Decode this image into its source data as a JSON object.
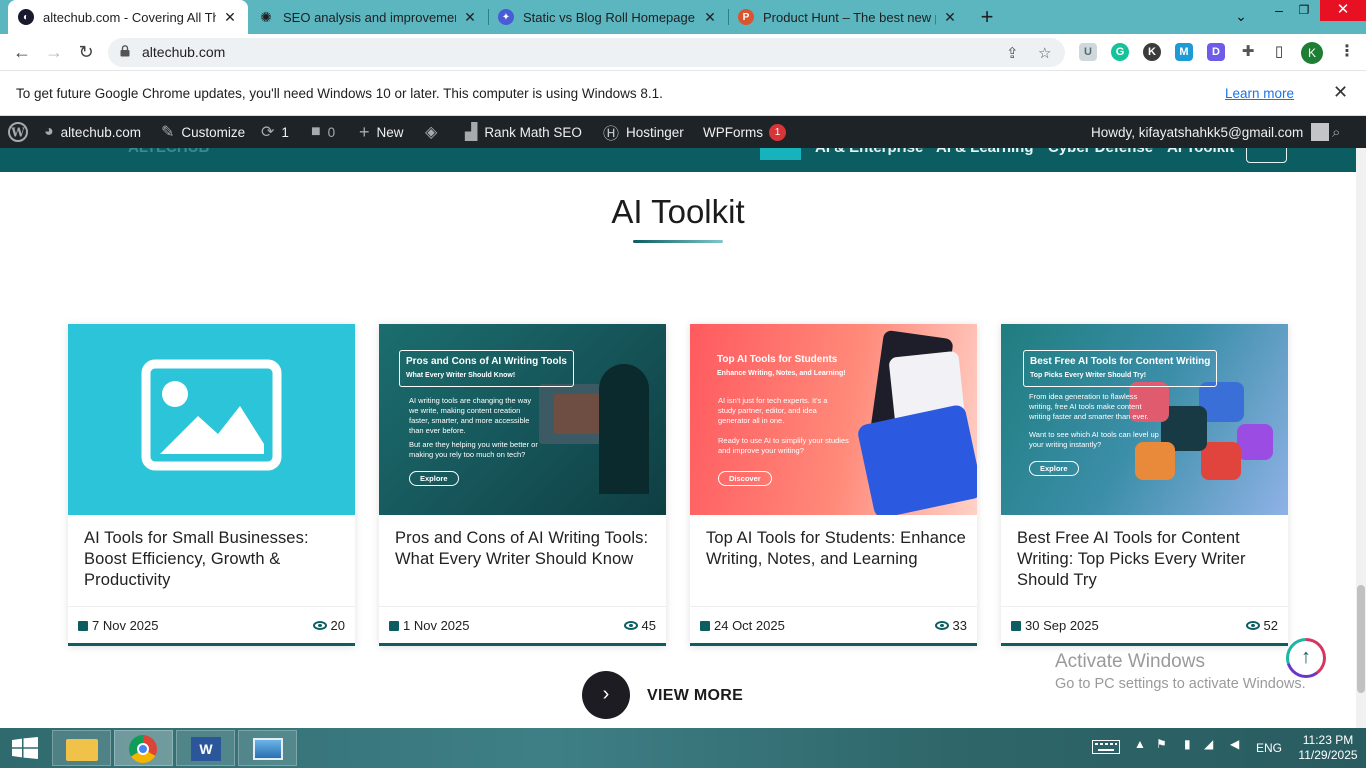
{
  "browser": {
    "tabs": [
      {
        "title": "altechub.com - Covering All Thin",
        "active": true
      },
      {
        "title": "SEO analysis and improvements",
        "active": false
      },
      {
        "title": "Static vs Blog Roll Homepage SEO",
        "active": false
      },
      {
        "title": "Product Hunt – The best new pro",
        "active": false
      }
    ],
    "url": "altechub.com",
    "profile_initial": "K",
    "extensions": [
      "U",
      "G",
      "K",
      "M",
      "D"
    ]
  },
  "infobar": {
    "message": "To get future Google Chrome updates, you'll need Windows 10 or later. This computer is using Windows 8.1.",
    "link": "Learn more"
  },
  "adminbar": {
    "site": "altechub.com",
    "customize": "Customize",
    "updates_count": "1",
    "comments_count": "0",
    "new": "New",
    "rankmath": "Rank Math SEO",
    "hostinger": "Hostinger",
    "wpforms": "WPForms",
    "wpforms_badge": "1",
    "howdy": "Howdy, kifayatshahkk5@gmail.com"
  },
  "site_header": {
    "logo": "ALTECHUB",
    "nav": [
      "AI & Enterprise",
      "AI & Learning",
      "Cyber Defense",
      "AI Toolkit"
    ]
  },
  "section": {
    "title": "AI Toolkit"
  },
  "cards": [
    {
      "title": "AI Tools for Small Businesses: Boost Efficiency, Growth & Productivity",
      "date": "7 Nov 2025",
      "views": "20",
      "placeholder": true
    },
    {
      "title": "Pros and Cons of AI Writing Tools: What Every Writer Should Know",
      "date": "1 Nov 2025",
      "views": "45",
      "thumb_heading": "Pros and Cons of AI Writing Tools",
      "thumb_sub": "What Every Writer Should Know!",
      "thumb_body1": "AI writing tools are changing the way we write, making content creation faster, smarter, and more accessible than ever before.",
      "thumb_body2": "But are they helping you write better or making you rely too much on tech?",
      "thumb_button": "Explore"
    },
    {
      "title": "Top AI Tools for Students: Enhance Writing, Notes, and Learning",
      "date": "24 Oct 2025",
      "views": "33",
      "thumb_heading": "Top AI Tools for Students",
      "thumb_sub": "Enhance Writing, Notes, and Learning!",
      "thumb_body1": "AI isn't just for tech experts. It's a study partner, editor, and idea generator all in one.",
      "thumb_body2": "Ready to use AI to simplify your studies and improve your writing?",
      "thumb_button": "Discover"
    },
    {
      "title": "Best Free AI Tools for Content Writing: Top Picks Every Writer Should Try",
      "date": "30 Sep 2025",
      "views": "52",
      "thumb_heading": "Best Free AI Tools for Content Writing",
      "thumb_sub": "Top Picks Every Writer Should Try!",
      "thumb_body1": "From idea generation to flawless writing, free AI tools make content writing faster and smarter than ever.",
      "thumb_body2": "Want to see which AI tools can level up your writing instantly?",
      "thumb_button": "Explore"
    }
  ],
  "view_more": "VIEW MORE",
  "activation": {
    "line1": "Activate Windows",
    "line2": "Go to PC settings to activate Windows."
  },
  "taskbar": {
    "lang": "ENG",
    "time": "11:23 PM",
    "date": "11/29/2025"
  },
  "colors": {
    "brand": "#0c5d62",
    "tabstrip": "#5bb6c0",
    "adminbar": "#1d2327"
  }
}
